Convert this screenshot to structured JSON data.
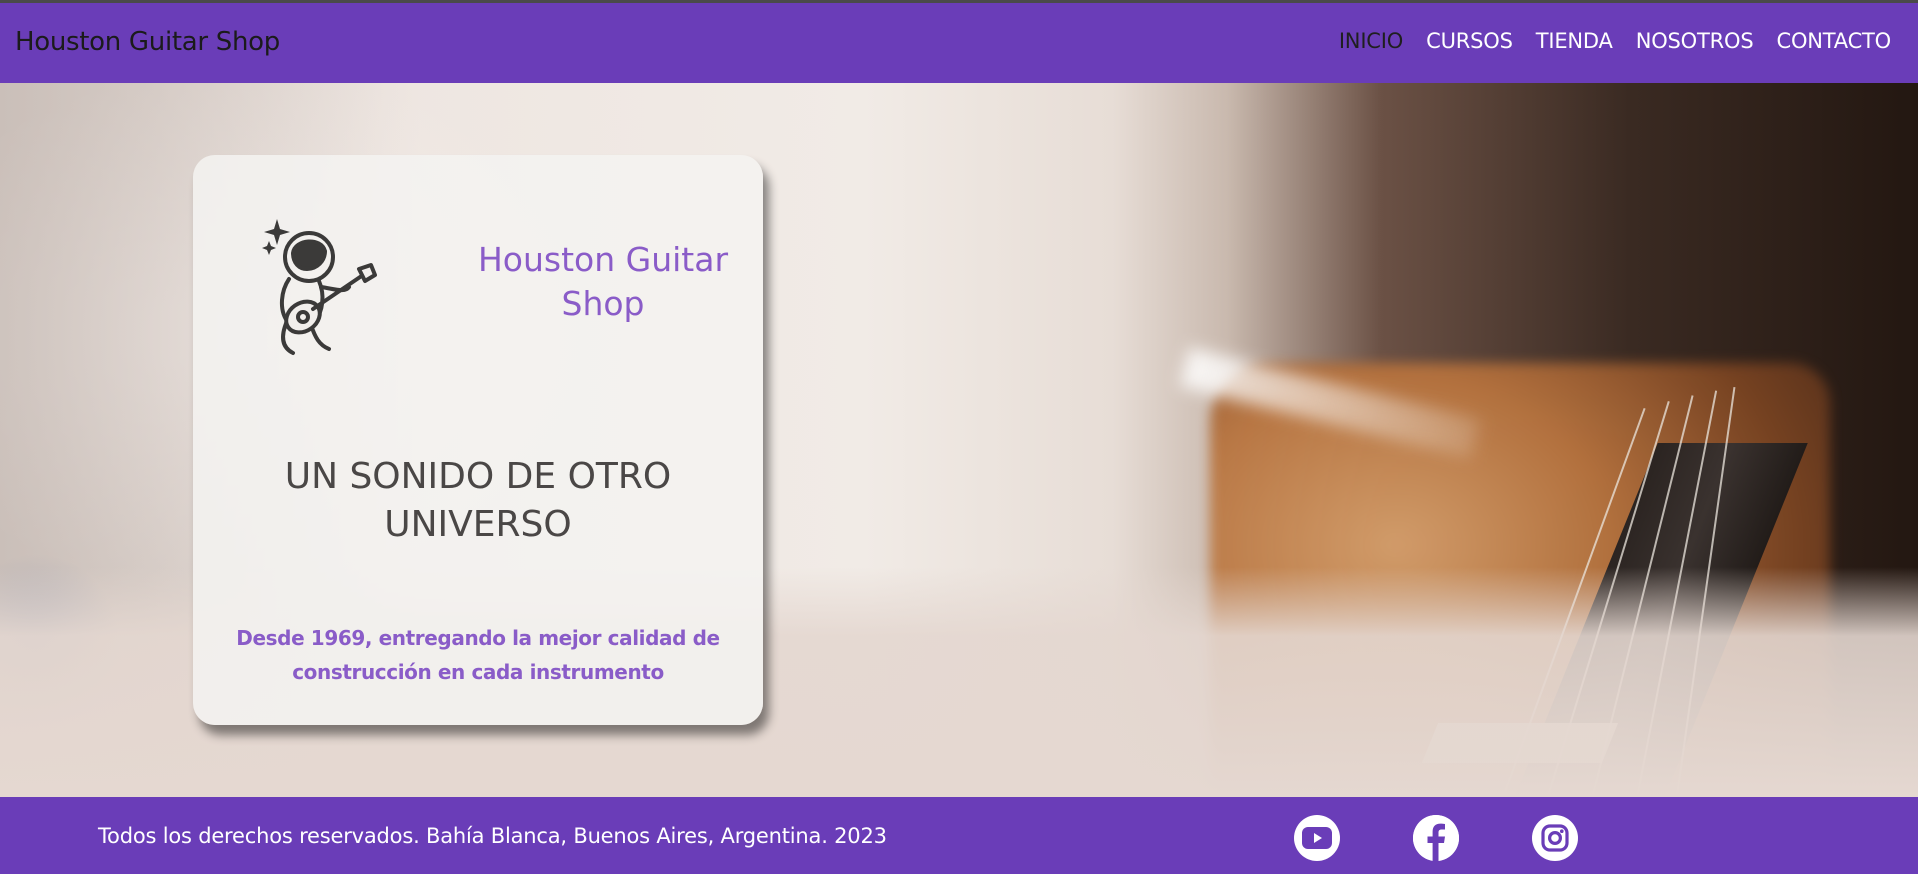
{
  "header": {
    "brand": "Houston Guitar Shop",
    "nav": [
      {
        "label": "INICIO",
        "active": true
      },
      {
        "label": "CURSOS",
        "active": false
      },
      {
        "label": "TIENDA",
        "active": false
      },
      {
        "label": "NOSOTROS",
        "active": false
      },
      {
        "label": "CONTACTO",
        "active": false
      }
    ]
  },
  "card": {
    "logo_icon": "astronaut-guitar-icon",
    "title": "Houston Guitar Shop",
    "headline": "UN SONIDO DE OTRO UNIVERSO",
    "subtitle": "Desde 1969, entregando la mejor calidad de construcción en cada instrumento"
  },
  "footer": {
    "copyright": "Todos los derechos reservados. Bahía Blanca, Buenos Aires, Argentina. 2023",
    "social": [
      {
        "icon": "youtube-icon"
      },
      {
        "icon": "facebook-icon"
      },
      {
        "icon": "instagram-icon"
      }
    ]
  },
  "colors": {
    "brand_purple": "#6a3db8",
    "accent_text": "#8a5cc8",
    "active_nav": "#1f1f1f"
  }
}
